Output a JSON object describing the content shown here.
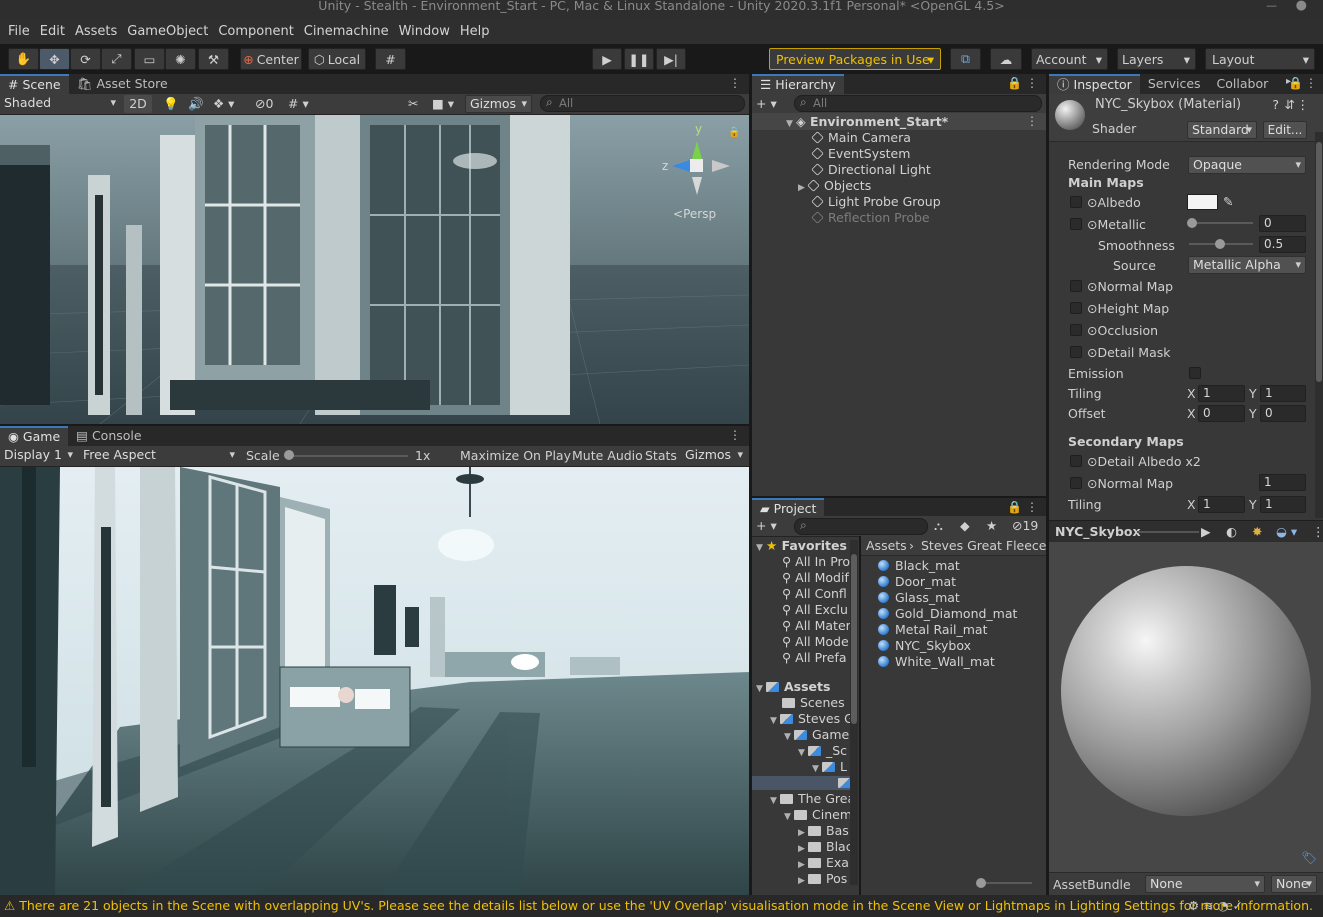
{
  "window": {
    "title": "Unity - Stealth - Environment_Start - PC, Mac & Linux Standalone - Unity 2020.3.1f1 Personal* <OpenGL 4.5>"
  },
  "menu": [
    "File",
    "Edit",
    "Assets",
    "GameObject",
    "Component",
    "Cinemachine",
    "Window",
    "Help"
  ],
  "toolbar": {
    "center": "Center",
    "local": "Local",
    "preview_packages": "Preview Packages in Use",
    "account": "Account",
    "layers": "Layers",
    "layout": "Layout"
  },
  "scene": {
    "tabs": [
      "Scene",
      "Asset Store"
    ],
    "shading": "Shaded",
    "mode2d": "2D",
    "hidden_count": "0",
    "gizmos": "Gizmos",
    "search_placeholder": "All",
    "axis_y": "y",
    "axis_z": "z",
    "persp": "Persp"
  },
  "game": {
    "tabs": [
      "Game",
      "Console"
    ],
    "display": "Display 1",
    "aspect": "Free Aspect",
    "scale_label": "Scale",
    "scale_value": "1x",
    "maximize": "Maximize On Play",
    "mute": "Mute Audio",
    "stats": "Stats",
    "gizmos": "Gizmos"
  },
  "hierarchy": {
    "tab": "Hierarchy",
    "search_placeholder": "All",
    "scene_name": "Environment_Start*",
    "items": [
      "Main Camera",
      "EventSystem",
      "Directional Light",
      "Objects",
      "Light Probe Group",
      "Reflection Probe"
    ]
  },
  "project": {
    "tab": "Project",
    "hidden_count": "19",
    "favorites_label": "Favorites",
    "favorites": [
      "All In Pro",
      "All Modif",
      "All Confl",
      "All Exclu",
      "All Mater",
      "All Mode",
      "All Prefa"
    ],
    "assets_label": "Assets",
    "tree": [
      "Scenes",
      "Steves G",
      "Game",
      "_Sc",
      "L",
      "",
      "The Grea",
      "Cinem",
      "Bas",
      "Blac",
      "Exa",
      "Pos"
    ],
    "breadcrumb": [
      "Assets",
      "Steves Great Fleece Fi"
    ],
    "files": [
      "Black_mat",
      "Door_mat",
      "Glass_mat",
      "Gold_Diamond_mat",
      "Metal Rail_mat",
      "NYC_Skybox",
      "White_Wall_mat"
    ]
  },
  "inspector": {
    "tabs": [
      "Inspector",
      "Services",
      "Collabor"
    ],
    "material_name": "NYC_Skybox (Material)",
    "shader_label": "Shader",
    "shader_value": "Standard",
    "edit": "Edit...",
    "rendering_mode_label": "Rendering Mode",
    "rendering_mode": "Opaque",
    "main_maps": "Main Maps",
    "albedo": "Albedo",
    "metallic": "Metallic",
    "metallic_value": "0",
    "smoothness": "Smoothness",
    "smoothness_value": "0.5",
    "source_label": "Source",
    "source": "Metallic Alpha",
    "normal_map": "Normal Map",
    "height_map": "Height Map",
    "occlusion": "Occlusion",
    "detail_mask": "Detail Mask",
    "emission": "Emission",
    "tiling": "Tiling",
    "offset": "Offset",
    "x": "X",
    "y": "Y",
    "tiling_x": "1",
    "tiling_y": "1",
    "offset_x": "0",
    "offset_y": "0",
    "secondary_maps": "Secondary Maps",
    "detail_albedo": "Detail Albedo x2",
    "sec_normal": "Normal Map",
    "sec_normal_value": "1",
    "sec_tiling": "Tiling",
    "sec_tiling_x": "1",
    "sec_tiling_y": "1",
    "preview_title": "NYC_Skybox",
    "assetbundle_label": "AssetBundle",
    "assetbundle_value": "None",
    "assetbundle_variant": "None"
  },
  "status": "There are 21 objects in the Scene with overlapping UV's. Please see the details list below or use the 'UV Overlap' visualisation mode in the Scene View or Lightmaps in Lighting Settings for more information.",
  "colors": {
    "accent": "#3a79bb",
    "warning": "#f2c100",
    "preview_border": "#c8a000"
  }
}
